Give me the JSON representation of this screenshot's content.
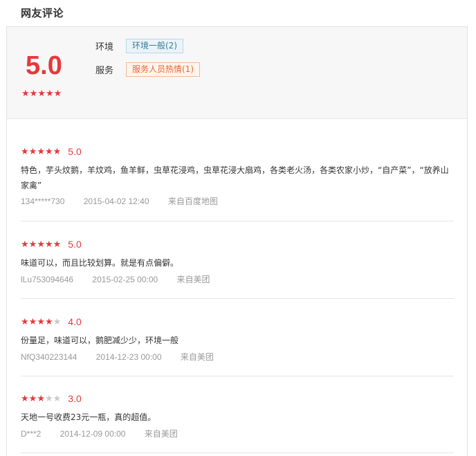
{
  "page_title": "网友评论",
  "summary": {
    "score": "5.0",
    "stars": 5,
    "tags": [
      {
        "label": "环境",
        "tag": "环境一般(2)"
      },
      {
        "label": "服务",
        "tag": "服务人员热情(1)"
      }
    ]
  },
  "reviews": [
    {
      "stars": 5,
      "score": "5.0",
      "text": "特色，芋头炆鹅，羊炆鸡，鱼羊鲜，虫草花浸鸡，虫草花浸大扇鸡，各类老火汤，各类农家小炒，“自产菜”，“放养山家禽”",
      "user": "134*****730",
      "time": "2015-04-02 12:40",
      "source": "来自百度地图"
    },
    {
      "stars": 5,
      "score": "5.0",
      "text": "味道可以，而且比较划算。就是有点偏僻。",
      "user": "lLu753094646",
      "time": "2015-02-25 00:00",
      "source": "来自美团"
    },
    {
      "stars": 4,
      "score": "4.0",
      "text": "份量足，味道可以，鹅肥减少少，环境一般",
      "user": "NfQ340223144",
      "time": "2014-12-23 00:00",
      "source": "来自美团"
    },
    {
      "stars": 3,
      "score": "3.0",
      "text": "天地一号收费23元一瓶，真的超值。",
      "user": "D***2",
      "time": "2014-12-09 00:00",
      "source": "来自美团"
    }
  ],
  "colors": {
    "accent": "#e4393c",
    "tag_neutral": "#3a7a9a",
    "tag_positive": "#f0652f",
    "meta": "#999999"
  }
}
